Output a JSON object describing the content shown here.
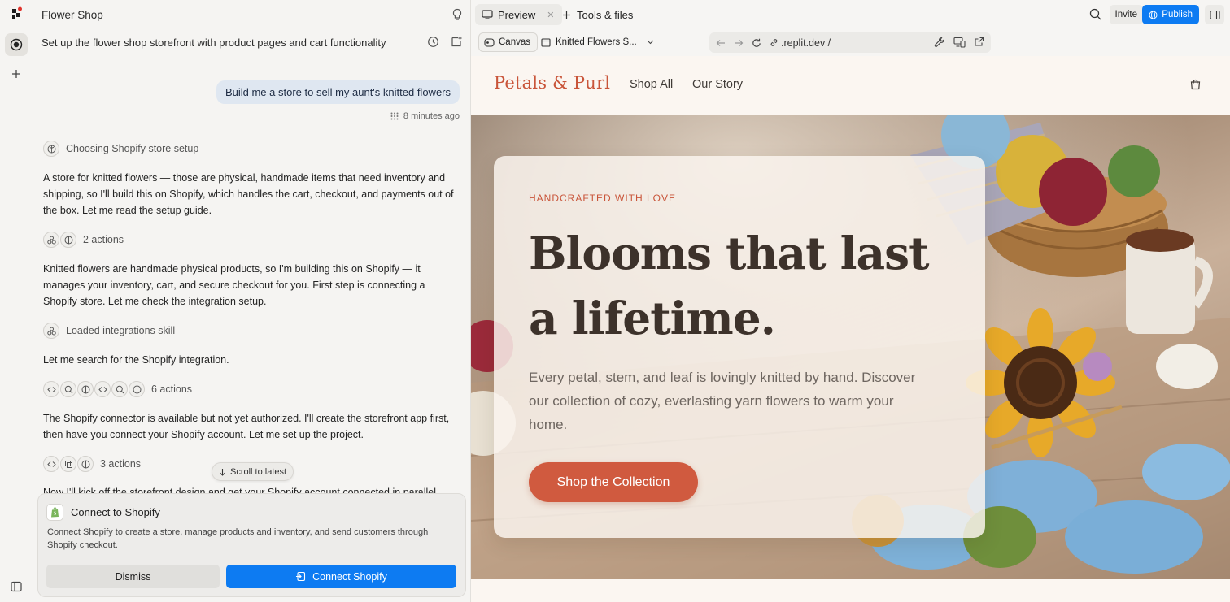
{
  "app": {
    "project_title": "Flower Shop",
    "task_title": "Set up the flower shop storefront with product pages and cart functionality"
  },
  "chat": {
    "user_message": "Build me a store to sell my aunt's knitted flowers",
    "user_message_time": "8 minutes ago",
    "step1": "Choosing Shopify store setup",
    "msg1": "A store for knitted flowers — those are physical, handmade items that need inventory and shipping, so I'll build this on Shopify, which handles the cart, checkout, and payments out of the box. Let me read the setup guide.",
    "actions1": "2 actions",
    "msg2": "Knitted flowers are handmade physical products, so I'm building this on Shopify — it manages your inventory, cart, and secure checkout for you. First step is connecting a Shopify store. Let me check the integration setup.",
    "step2": "Loaded integrations skill",
    "msg3": "Let me search for the Shopify integration.",
    "actions2": "6 actions",
    "msg4": "The Shopify connector is available but not yet authorized. I'll create the storefront app first, then have you connect your Shopify account. Let me set up the project.",
    "actions3": "3 actions",
    "msg5": "Now I'll kick off the storefront design and get your Shopify account connected in parallel.",
    "scroll_latest": "Scroll to latest"
  },
  "connect_card": {
    "title": "Connect to Shopify",
    "description": "Connect Shopify to create a store, manage products and inventory, and send customers through Shopify checkout.",
    "dismiss_label": "Dismiss",
    "connect_label": "Connect Shopify"
  },
  "preview": {
    "tab_preview": "Preview",
    "tab_tools": "Tools & files",
    "invite_label": "Invite",
    "publish_label": "Publish",
    "canvas_label": "Canvas",
    "page_select": "Knitted Flowers S...",
    "url": ".replit.dev /"
  },
  "site": {
    "brand": "Petals & Purl",
    "nav_shop_all": "Shop All",
    "nav_our_story": "Our Story",
    "eyebrow": "HANDCRAFTED WITH LOVE",
    "headline": "Blooms that last a lifetime.",
    "description": "Every petal, stem, and leaf is lovingly knitted by hand. Discover our collection of cozy, everlasting yarn flowers to warm your home.",
    "cta_label": "Shop the Collection"
  },
  "colors": {
    "accent_blue": "#0d7bf2",
    "brand_terracotta": "#c9553a",
    "cta": "#d05a3f"
  },
  "icons": [
    "replit-logo-icon",
    "agent-icon",
    "plus-icon",
    "bulb-icon",
    "history-icon",
    "new-chat-icon",
    "brain-icon",
    "skill-icon",
    "code-icon",
    "search-icon",
    "copy-icon",
    "arrow-down-icon",
    "shopify-icon",
    "connect-icon",
    "sidebar-toggle-icon",
    "monitor-icon",
    "close-icon",
    "file-icon",
    "chevron-down-icon",
    "back-icon",
    "forward-icon",
    "reload-icon",
    "link-icon",
    "wrench-icon",
    "devices-icon",
    "external-link-icon",
    "globe-icon",
    "layout-icon",
    "cart-icon"
  ]
}
